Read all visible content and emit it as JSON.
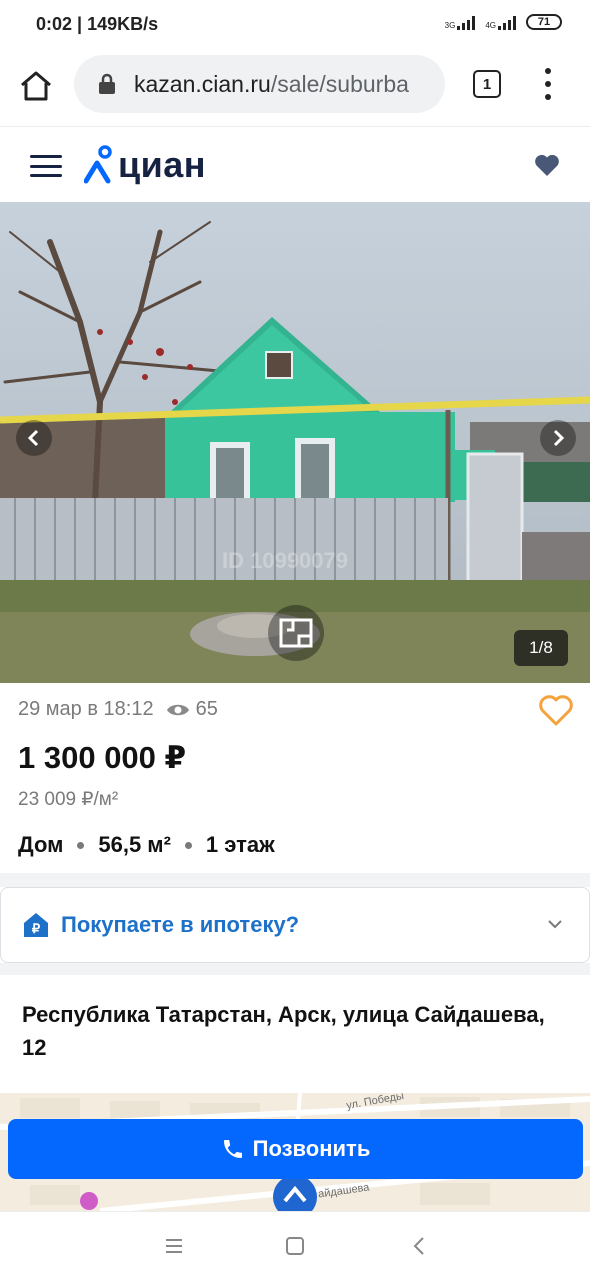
{
  "status_bar": {
    "time": "0:02",
    "speed": "149KB/s",
    "net1": "3G",
    "net2": "4G",
    "battery": "71"
  },
  "browser": {
    "url_host": "kazan.cian.ru",
    "url_path": "/sale/suburba",
    "tab_count": "1",
    "icons": [
      "home-icon",
      "lock-icon",
      "tabs-icon",
      "more-vertical-icon"
    ]
  },
  "site_header": {
    "logo_text": "циан",
    "icons": [
      "menu-icon",
      "logo-pin-icon",
      "heart-icon"
    ]
  },
  "photo": {
    "counter": "1/8",
    "watermark": "ID 10990079",
    "icons": [
      "chevron-left-icon",
      "chevron-right-icon",
      "floor-plan-icon"
    ]
  },
  "listing": {
    "date": "29 мар в 18:12",
    "views": "65",
    "price": "1 300 000 ₽",
    "price_per_m2": "23 009 ₽/м²",
    "specs": {
      "type": "Дом",
      "area": "56,5 м²",
      "floors": "1 этаж"
    },
    "mortgage_label": "Покупаете в ипотеку?",
    "address": "Республика Татарстан, Арск, улица Сайдашева, 12"
  },
  "map": {
    "street1": "ул. Победы",
    "street2": "айдашева"
  },
  "call_button": {
    "label": "Позвонить"
  },
  "colors": {
    "brand_blue": "#0468ff",
    "link_blue": "#1d71c9",
    "fav_orange": "#f4a23b",
    "navy": "#152242"
  }
}
